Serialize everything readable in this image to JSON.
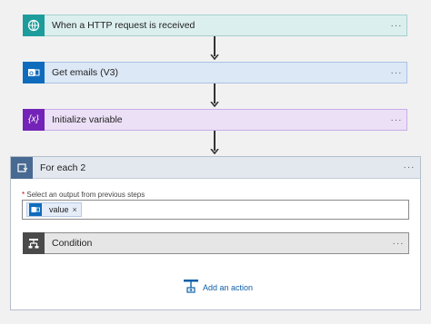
{
  "steps": {
    "http": {
      "label": "When a HTTP request is received",
      "icon": "http-request-icon",
      "more": "···"
    },
    "emails": {
      "label": "Get emails (V3)",
      "icon": "outlook-icon",
      "more": "···"
    },
    "variable": {
      "label": "Initialize variable",
      "icon": "variable-icon",
      "icon_text": "{x}",
      "more": "···"
    }
  },
  "foreach": {
    "label": "For each 2",
    "icon": "loop-icon",
    "more": "···",
    "select_required": "*",
    "select_label": "Select an output from previous steps",
    "token": {
      "label": "value",
      "remove": "×",
      "icon": "outlook-icon"
    },
    "condition": {
      "label": "Condition",
      "icon": "condition-icon",
      "more": "···"
    },
    "add_action": {
      "label": "Add an action",
      "icon": "add-action-icon"
    }
  },
  "colors": {
    "http_accent": "#1e9c9c",
    "emails_accent": "#0f6cbd",
    "variable_accent": "#7323b8",
    "loop_accent": "#486991",
    "condition_accent": "#4a4a4a"
  }
}
